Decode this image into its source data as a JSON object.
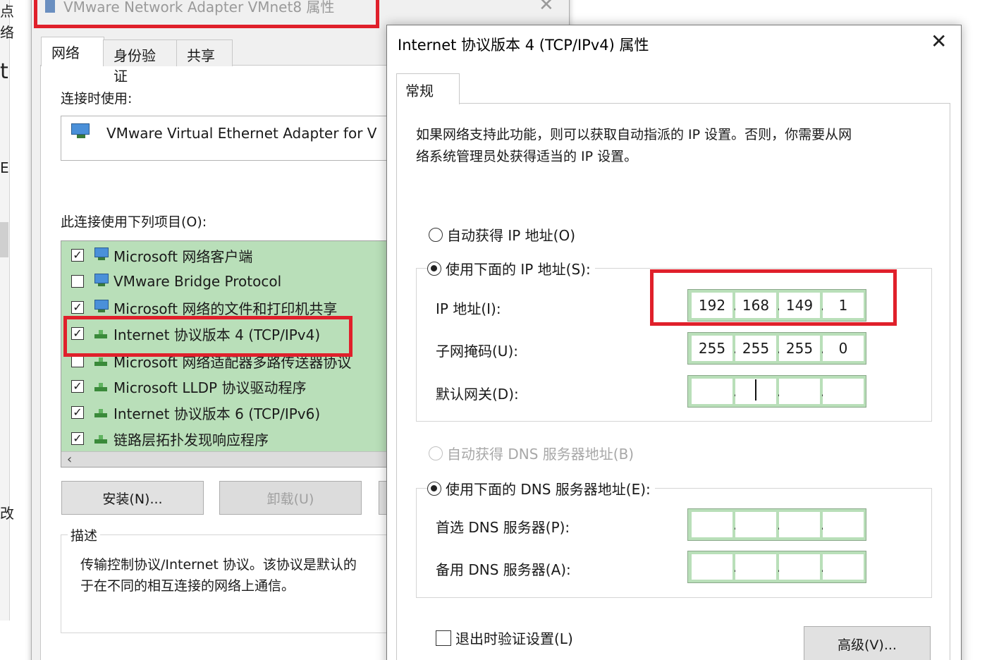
{
  "left_dialog": {
    "title": "VMware Network Adapter VMnet8 属性",
    "tabs": [
      "网络",
      "身份验证",
      "共享"
    ],
    "connect_using_label": "连接时使用:",
    "adapter_name": "VMware Virtual Ethernet Adapter for V",
    "items_label": "此连接使用下列项目(O):",
    "items": [
      {
        "label": "Microsoft 网络客户端",
        "checked": true,
        "icon": "network-client-icon"
      },
      {
        "label": "VMware Bridge Protocol",
        "checked": false,
        "icon": "network-client-icon"
      },
      {
        "label": "Microsoft 网络的文件和打印机共享",
        "checked": true,
        "icon": "network-client-icon"
      },
      {
        "label": "Internet 协议版本 4 (TCP/IPv4)",
        "checked": true,
        "icon": "protocol-icon"
      },
      {
        "label": "Microsoft 网络适配器多路传送器协议",
        "checked": false,
        "icon": "protocol-icon"
      },
      {
        "label": "Microsoft LLDP 协议驱动程序",
        "checked": true,
        "icon": "protocol-icon"
      },
      {
        "label": "Internet 协议版本 6 (TCP/IPv6)",
        "checked": true,
        "icon": "protocol-icon"
      },
      {
        "label": "链路层拓扑发现响应程序",
        "checked": true,
        "icon": "protocol-icon"
      }
    ],
    "install_label": "安装(N)...",
    "uninstall_label": "卸载(U)",
    "description_legend": "描述",
    "description_text_1": "传输控制协议/Internet 协议。该协议是默认的",
    "description_text_2": "于在不同的相互连接的网络上通信。"
  },
  "right_dialog": {
    "title": "Internet 协议版本 4 (TCP/IPv4) 属性",
    "tab": "常规",
    "description_1": "如果网络支持此功能，则可以获取自动指派的 IP 设置。否则，你需要从网",
    "description_2": "络系统管理员处获得适当的 IP 设置。",
    "auto_ip_label": "自动获得 IP 地址(O)",
    "manual_ip_label": "使用下面的 IP 地址(S):",
    "ip_label": "IP 地址(I):",
    "ip": [
      "192",
      "168",
      "149",
      "1"
    ],
    "mask_label": "子网掩码(U):",
    "mask": [
      "255",
      "255",
      "255",
      "0"
    ],
    "gateway_label": "默认网关(D):",
    "gateway": [
      "",
      "",
      "",
      ""
    ],
    "auto_dns_label": "自动获得 DNS 服务器地址(B)",
    "manual_dns_label": "使用下面的 DNS 服务器地址(E):",
    "dns1_label": "首选 DNS 服务器(P):",
    "dns2_label": "备用 DNS 服务器(A):",
    "validate_label": "退出时验证设置(L)",
    "advanced_label": "高级(V)..."
  },
  "colors": {
    "highlight_red": "#e0202b",
    "field_green": "#b9dfb9"
  }
}
